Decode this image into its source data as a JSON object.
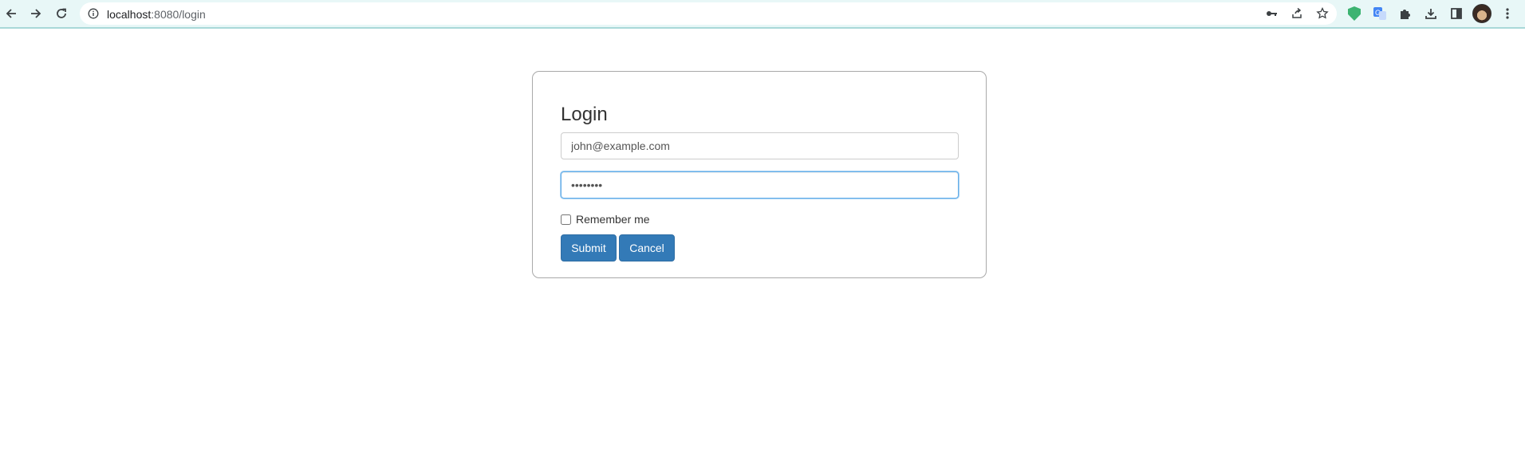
{
  "browser": {
    "url_host": "localhost",
    "url_path": ":8080/login",
    "icons": [
      "back-icon",
      "forward-icon",
      "reload-icon",
      "info-icon",
      "key-icon",
      "share-icon",
      "bookmark-star-icon",
      "extension-shield-icon",
      "translate-icon",
      "puzzle-icon",
      "download-icon",
      "sidepanel-icon",
      "profile-avatar",
      "kebab-menu-icon"
    ]
  },
  "login": {
    "title": "Login",
    "email_value": "john@example.com",
    "password_value": "••••••••",
    "remember_label": "Remember me",
    "remember_checked": false,
    "submit_label": "Submit",
    "cancel_label": "Cancel"
  },
  "colors": {
    "toolbar_bg": "#e8f7f7",
    "button_primary": "#337ab7",
    "focus_border": "#66afe9",
    "card_border": "#a9a9a9"
  }
}
